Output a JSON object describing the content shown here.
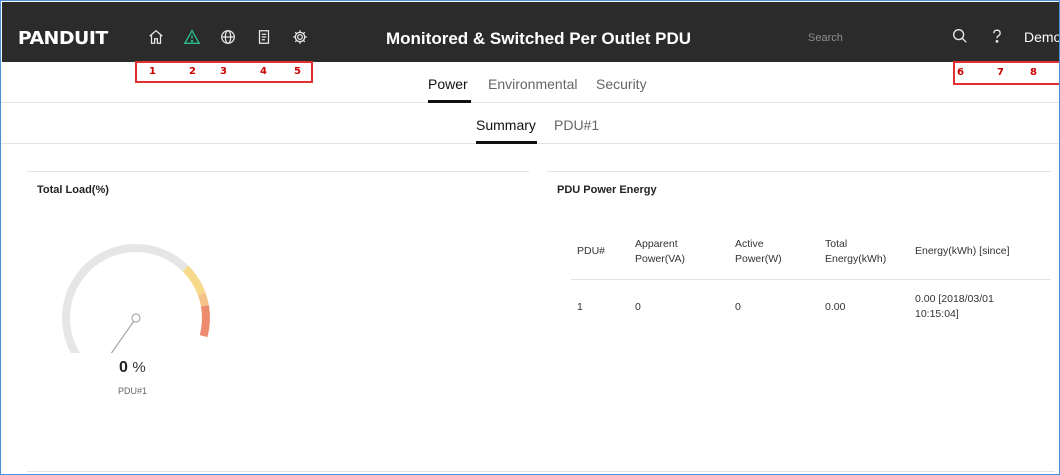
{
  "header": {
    "logo": "PANDUIT",
    "title": "Monitored & Switched Per Outlet PDU",
    "search_placeholder": "Search",
    "user": "Demo",
    "nav_icons": [
      "home-icon",
      "alert-icon",
      "globe-icon",
      "document-icon",
      "gear-icon"
    ],
    "right_icons": [
      "search-icon",
      "help-icon"
    ],
    "colors": {
      "bar": "#2b2b2b",
      "alert": "#2bbf8a"
    }
  },
  "annotations": {
    "left": [
      "1",
      "2",
      "3",
      "4",
      "5"
    ],
    "right": [
      "6",
      "7",
      "8"
    ]
  },
  "main_tabs": [
    {
      "label": "Power",
      "active": true
    },
    {
      "label": "Environmental",
      "active": false
    },
    {
      "label": "Security",
      "active": false
    }
  ],
  "sub_tabs": [
    {
      "label": "Summary",
      "active": true
    },
    {
      "label": "PDU#1",
      "active": false
    }
  ],
  "total_load": {
    "title": "Total Load(%)",
    "value": "0",
    "unit": "%",
    "label": "PDU#1",
    "value_fraction": 0,
    "colors": {
      "track": "#e6e6e6",
      "warn": "#f6d98a",
      "warn2": "#f3c38a",
      "danger": "#ee8b6e"
    }
  },
  "energy": {
    "title": "PDU Power Energy",
    "headers": [
      "PDU#",
      "Apparent Power(VA)",
      "Active Power(W)",
      "Total Energy(kWh)",
      "Energy(kWh) [since]"
    ],
    "rows": [
      [
        "1",
        "0",
        "0",
        "0.00",
        "0.00 [2018/03/01 10:15:04]"
      ]
    ]
  }
}
